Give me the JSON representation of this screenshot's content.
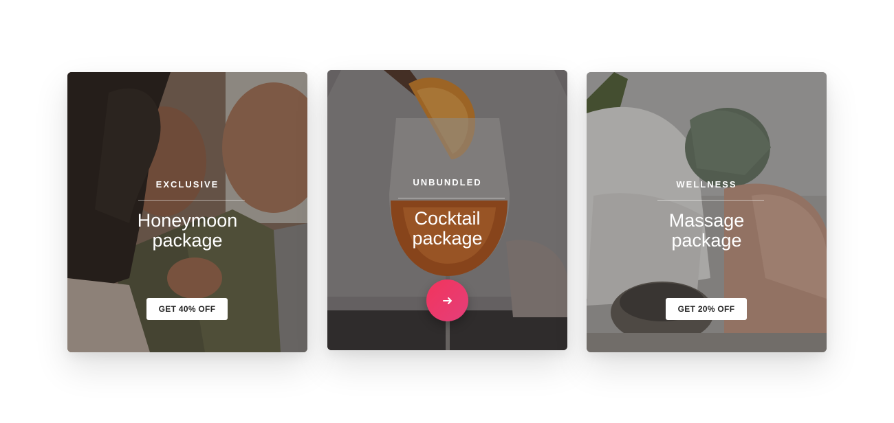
{
  "cards": [
    {
      "eyebrow": "EXCLUSIVE",
      "title_line1": "Honeymoon",
      "title_line2": "package",
      "cta_label": "GET 40% OFF"
    },
    {
      "eyebrow": "UNBUNDLED",
      "title_line1": "Cocktail",
      "title_line2": "package",
      "action_icon": "arrow-right-icon"
    },
    {
      "eyebrow": "WELLNESS",
      "title_line1": "Massage",
      "title_line2": "package",
      "cta_label": "GET 20% OFF"
    }
  ],
  "colors": {
    "action_button": "#ee3867",
    "cta_background": "#ffffff",
    "cta_text": "#222222",
    "overlay_text": "#ffffff"
  }
}
